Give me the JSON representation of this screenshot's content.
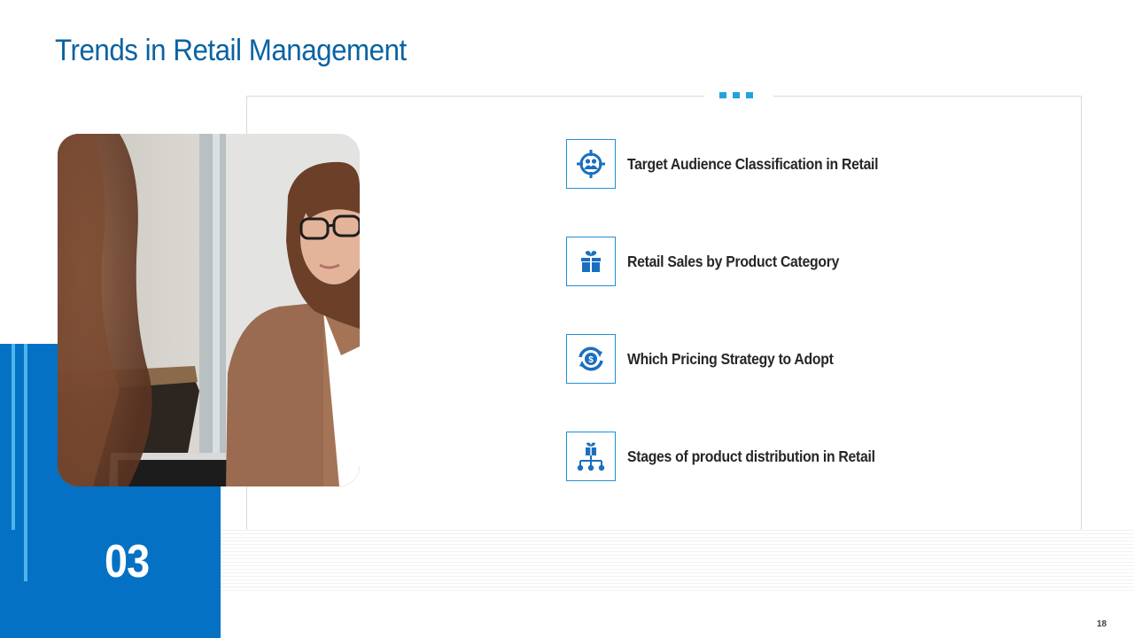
{
  "slide": {
    "title": "Trends in Retail Management",
    "section_number": "03",
    "page_number": "18"
  },
  "items": [
    {
      "label": "Target Audience Classification in Retail",
      "icon": "audience-target-icon"
    },
    {
      "label": "Retail Sales by Product Category",
      "icon": "gift-box-icon"
    },
    {
      "label": "Which Pricing Strategy to Adopt",
      "icon": "dollar-cycle-icon"
    },
    {
      "label": "Stages of product distribution in Retail",
      "icon": "distribution-hierarchy-icon"
    }
  ],
  "colors": {
    "title": "#0a62a3",
    "accent_block": "#0471c4",
    "accent_light": "#4fb3ec",
    "icon": "#1a6fc0",
    "dots": "#21a3dc"
  }
}
